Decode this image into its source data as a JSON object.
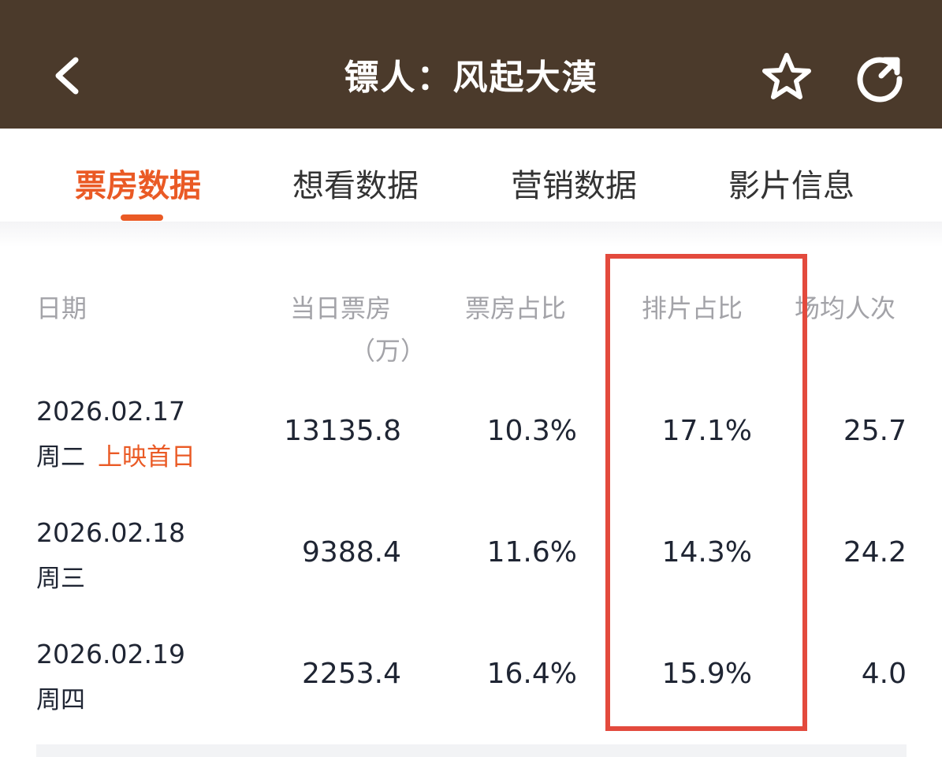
{
  "header": {
    "title": "镖人：风起大漠",
    "back_icon": "chevron-left-icon",
    "favorite_icon": "star-icon",
    "refresh_icon": "refresh-icon",
    "background": "#4b3a2b"
  },
  "tabs": [
    {
      "label": "票房数据",
      "active": true
    },
    {
      "label": "想看数据",
      "active": false
    },
    {
      "label": "营销数据",
      "active": false
    },
    {
      "label": "影片信息",
      "active": false
    }
  ],
  "accent_color": "#ea5a25",
  "table": {
    "columns": [
      "日期",
      "当日票房",
      "（万）",
      "票房占比",
      "排片占比",
      "场均人次"
    ],
    "rows": [
      {
        "date": "2026.02.17",
        "weekday": "周二",
        "note": "上映首日",
        "box_office": "13135.8",
        "box_share": "10.3%",
        "schedule_share": "17.1%",
        "avg_viewers": "25.7"
      },
      {
        "date": "2026.02.18",
        "weekday": "周三",
        "note": "",
        "box_office": "9388.4",
        "box_share": "11.6%",
        "schedule_share": "14.3%",
        "avg_viewers": "24.2"
      },
      {
        "date": "2026.02.19",
        "weekday": "周四",
        "note": "",
        "box_office": "2253.4",
        "box_share": "16.4%",
        "schedule_share": "15.9%",
        "avg_viewers": "4.0"
      }
    ]
  },
  "highlight_color": "#e34a3d"
}
